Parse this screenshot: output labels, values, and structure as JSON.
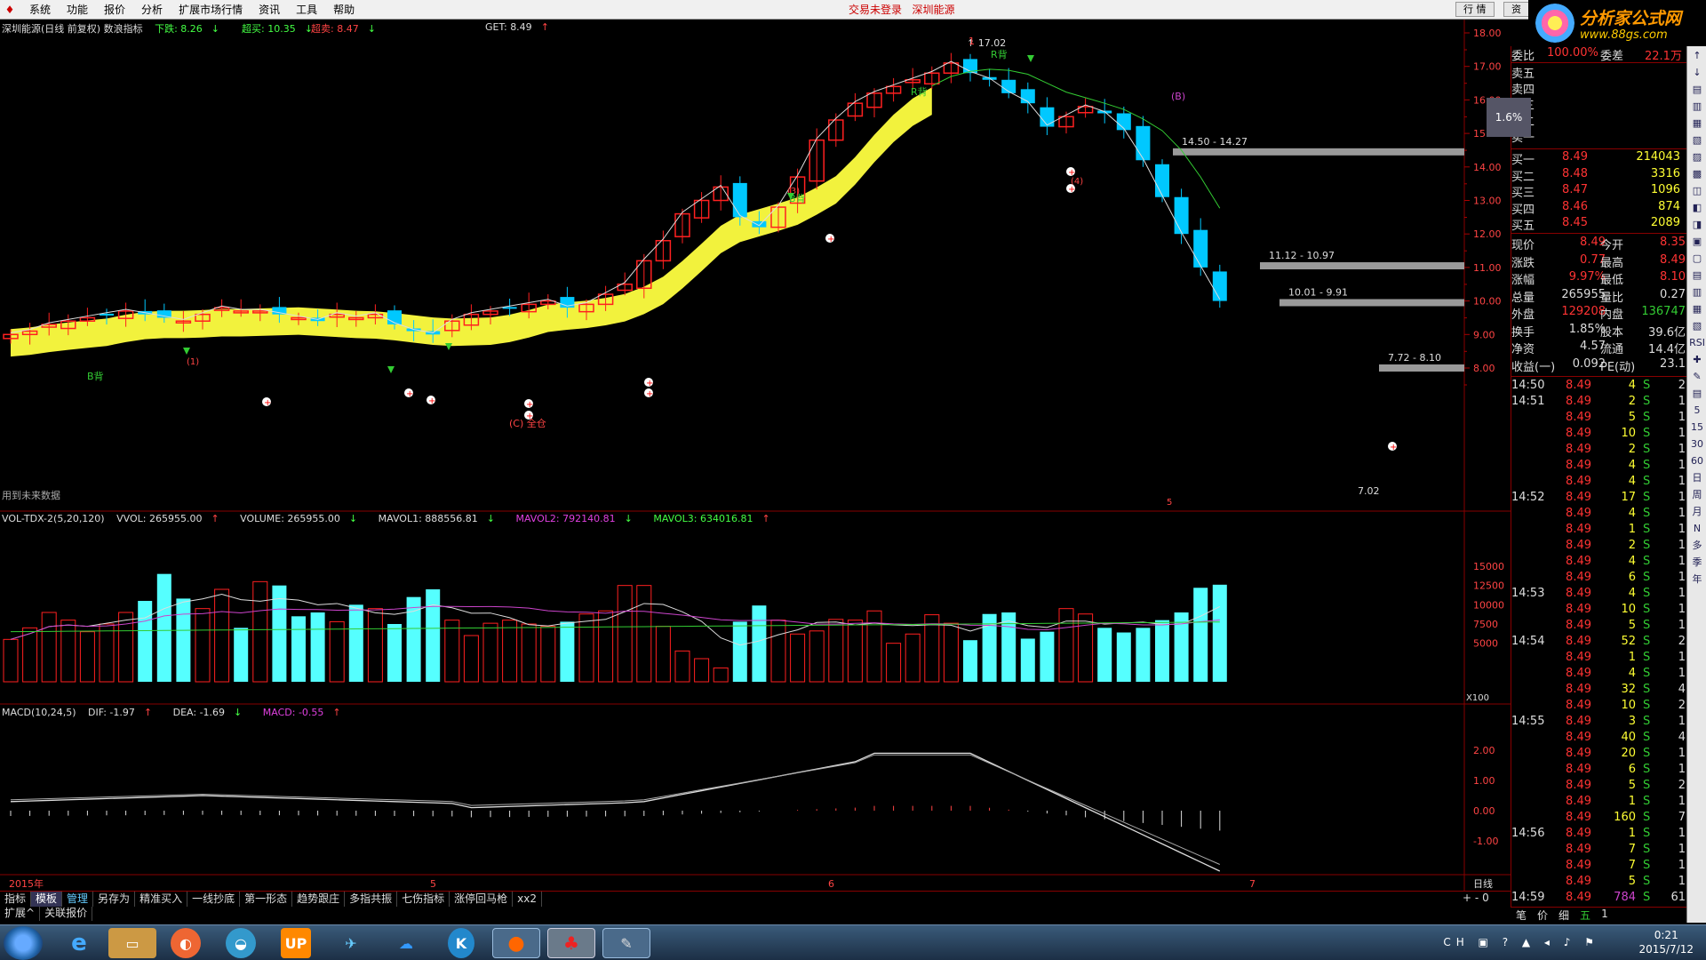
{
  "menu": {
    "items": [
      "系统",
      "功能",
      "报价",
      "分析",
      "扩展市场行情",
      "资讯",
      "工具",
      "帮助"
    ],
    "center_login": "交易未登录",
    "center_stock": "深圳能源",
    "btn_quote": "行 情",
    "btn_info": "资"
  },
  "brand": {
    "title": "分析家公式网",
    "url": "www.88gs.com"
  },
  "main_header": {
    "title": "深圳能源(日线 前复权) 数浪指标",
    "down_label": "下跌: 8.26",
    "down_arrow": "↓",
    "buy_label": "超买: 10.35",
    "buy_arrow": "↓",
    "sell_label": "超卖: 8.47",
    "sell_arrow": "↓",
    "get_label": "GET: 8.49",
    "get_arrow": "↑",
    "future_note": "用到未来数据"
  },
  "price_axis": {
    "ticks": [
      "18.00",
      "17.00",
      "16.00",
      "15.00",
      "14.00",
      "13.00",
      "12.00",
      "11.00",
      "10.00",
      "9.00",
      "8.00"
    ],
    "badge": "1.6%"
  },
  "annotations": {
    "high": "17.02",
    "low": "7.02",
    "z1": "14.50 - 14.27",
    "z2": "11.12 - 10.97",
    "z3": "10.01 - 9.91",
    "z4": "7.72 - 8.10",
    "bbei1": "B背",
    "bbei2": "B背",
    "bbei3": "R背",
    "bbei4": "R背",
    "c_label": "(C) 全仓",
    "b_label": "(B)",
    "n1": "(1)",
    "n3": "(3)",
    "n5": "5",
    "n4": "(4)",
    "one_top": "1"
  },
  "vol_header": {
    "name": "VOL-TDX-2(5,20,120)",
    "vvol": "VVOL: 265955.00",
    "vvol_arrow": "↑",
    "volume": "VOLUME: 265955.00",
    "volume_arrow": "↓",
    "mavol1": "MAVOL1: 888556.81",
    "mavol1_arrow": "↓",
    "mavol2": "MAVOL2: 792140.81",
    "mavol2_arrow": "↓",
    "mavol3": "MAVOL3: 634016.81",
    "mavol3_arrow": "↑"
  },
  "vol_axis": {
    "ticks": [
      "15000",
      "12500",
      "10000",
      "7500",
      "5000"
    ],
    "unit": "X100"
  },
  "macd_header": {
    "name": "MACD(10,24,5)",
    "dif": "DIF: -1.97",
    "dif_arrow": "↑",
    "dea": "DEA: -1.69",
    "dea_arrow": "↓",
    "macd": "MACD: -0.55",
    "macd_arrow": "↑"
  },
  "macd_axis": {
    "ticks": [
      "2.00",
      "1.00",
      "0.00",
      "-1.00"
    ]
  },
  "date_axis": {
    "labels": [
      "2015年",
      "5",
      "6",
      "7"
    ],
    "period": "日线",
    "controls": [
      "+",
      "-",
      "0"
    ]
  },
  "bottom_tabs": [
    "指标",
    "模板",
    "管理",
    "另存为",
    "精准买入",
    "一线抄底",
    "第一形态",
    "趋势跟庄",
    "多指共振",
    "七伤指标",
    "涨停回马枪",
    "xx2"
  ],
  "sub_tabs": [
    "扩展^",
    "关联报价"
  ],
  "quote": {
    "weibi_label": "委比",
    "weibi": "100.00%",
    "weicha_label": "委差",
    "weicha": "22.1万",
    "asks": [
      {
        "label": "卖五"
      },
      {
        "label": "卖四"
      },
      {
        "label": "卖三"
      },
      {
        "label": "卖二"
      },
      {
        "label": "卖一"
      }
    ],
    "bids": [
      {
        "label": "买一",
        "price": "8.49",
        "vol": "214043"
      },
      {
        "label": "买二",
        "price": "8.48",
        "vol": "3316"
      },
      {
        "label": "买三",
        "price": "8.47",
        "vol": "1096"
      },
      {
        "label": "买四",
        "price": "8.46",
        "vol": "874"
      },
      {
        "label": "买五",
        "price": "8.45",
        "vol": "2089"
      }
    ],
    "stats": [
      {
        "l1": "现价",
        "v1": "8.49",
        "l2": "今开",
        "v2": "8.35"
      },
      {
        "l1": "涨跌",
        "v1": "0.77",
        "l2": "最高",
        "v2": "8.49"
      },
      {
        "l1": "涨幅",
        "v1": "9.97%",
        "l2": "最低",
        "v2": "8.10"
      },
      {
        "l1": "总量",
        "v1": "265955",
        "l2": "量比",
        "v2": "0.27"
      },
      {
        "l1": "外盘",
        "v1": "129208",
        "l2": "内盘",
        "v2": "136747"
      },
      {
        "l1": "换手",
        "v1": "1.85%",
        "l2": "股本",
        "v2": "39.6亿"
      },
      {
        "l1": "净资",
        "v1": "4.57",
        "l2": "流通",
        "v2": "14.4亿"
      },
      {
        "l1": "收益(一)",
        "v1": "0.092",
        "l2": "PE(动)",
        "v2": "23.1"
      }
    ],
    "ticks": [
      {
        "t": "14:50",
        "p": "8.49",
        "v": "4",
        "s": "S",
        "n": "2"
      },
      {
        "t": "14:51",
        "p": "8.49",
        "v": "2",
        "s": "S",
        "n": "1"
      },
      {
        "t": "",
        "p": "8.49",
        "v": "5",
        "s": "S",
        "n": "1"
      },
      {
        "t": "",
        "p": "8.49",
        "v": "10",
        "s": "S",
        "n": "1"
      },
      {
        "t": "",
        "p": "8.49",
        "v": "2",
        "s": "S",
        "n": "1"
      },
      {
        "t": "",
        "p": "8.49",
        "v": "4",
        "s": "S",
        "n": "1"
      },
      {
        "t": "",
        "p": "8.49",
        "v": "4",
        "s": "S",
        "n": "1"
      },
      {
        "t": "14:52",
        "p": "8.49",
        "v": "17",
        "s": "S",
        "n": "1"
      },
      {
        "t": "",
        "p": "8.49",
        "v": "4",
        "s": "S",
        "n": "1"
      },
      {
        "t": "",
        "p": "8.49",
        "v": "1",
        "s": "S",
        "n": "1"
      },
      {
        "t": "",
        "p": "8.49",
        "v": "2",
        "s": "S",
        "n": "1"
      },
      {
        "t": "",
        "p": "8.49",
        "v": "4",
        "s": "S",
        "n": "1"
      },
      {
        "t": "",
        "p": "8.49",
        "v": "6",
        "s": "S",
        "n": "1"
      },
      {
        "t": "14:53",
        "p": "8.49",
        "v": "4",
        "s": "S",
        "n": "1"
      },
      {
        "t": "",
        "p": "8.49",
        "v": "10",
        "s": "S",
        "n": "1"
      },
      {
        "t": "",
        "p": "8.49",
        "v": "5",
        "s": "S",
        "n": "1"
      },
      {
        "t": "14:54",
        "p": "8.49",
        "v": "52",
        "s": "S",
        "n": "2"
      },
      {
        "t": "",
        "p": "8.49",
        "v": "1",
        "s": "S",
        "n": "1"
      },
      {
        "t": "",
        "p": "8.49",
        "v": "4",
        "s": "S",
        "n": "1"
      },
      {
        "t": "",
        "p": "8.49",
        "v": "32",
        "s": "S",
        "n": "4"
      },
      {
        "t": "",
        "p": "8.49",
        "v": "10",
        "s": "S",
        "n": "2"
      },
      {
        "t": "14:55",
        "p": "8.49",
        "v": "3",
        "s": "S",
        "n": "1"
      },
      {
        "t": "",
        "p": "8.49",
        "v": "40",
        "s": "S",
        "n": "4"
      },
      {
        "t": "",
        "p": "8.49",
        "v": "20",
        "s": "S",
        "n": "1"
      },
      {
        "t": "",
        "p": "8.49",
        "v": "6",
        "s": "S",
        "n": "1"
      },
      {
        "t": "",
        "p": "8.49",
        "v": "5",
        "s": "S",
        "n": "2"
      },
      {
        "t": "",
        "p": "8.49",
        "v": "1",
        "s": "S",
        "n": "1"
      },
      {
        "t": "",
        "p": "8.49",
        "v": "160",
        "s": "S",
        "n": "7"
      },
      {
        "t": "14:56",
        "p": "8.49",
        "v": "1",
        "s": "S",
        "n": "1"
      },
      {
        "t": "",
        "p": "8.49",
        "v": "7",
        "s": "S",
        "n": "1"
      },
      {
        "t": "",
        "p": "8.49",
        "v": "7",
        "s": "S",
        "n": "1"
      },
      {
        "t": "",
        "p": "8.49",
        "v": "5",
        "s": "S",
        "n": "1"
      },
      {
        "t": "14:59",
        "p": "8.49",
        "v": "784",
        "s": "S",
        "n": "61"
      }
    ],
    "footer": [
      "笔",
      "价",
      "细",
      "五",
      "1"
    ]
  },
  "side_icons": [
    "↑",
    "↓",
    "▤",
    "▥",
    "▦",
    "▧",
    "▨",
    "▩",
    "◫",
    "◧",
    "◨",
    "▣",
    "▢",
    "▤",
    "▥",
    "▦",
    "▧",
    "RSI",
    "✚",
    "✎",
    "▤",
    "5",
    "15",
    "30",
    "60",
    "日",
    "周",
    "月",
    "N",
    "多",
    "季",
    "年"
  ],
  "taskbar": {
    "apps": [
      "",
      "e",
      "",
      "",
      "",
      "UP",
      "",
      "",
      "K",
      "",
      "",
      ""
    ],
    "lang": "CH",
    "time": "0:21",
    "date": "2015/7/12"
  },
  "colors": {
    "up": "#ff2020",
    "down": "#00c8ff",
    "yellow": "#ffff40",
    "cyan": "#55ffff",
    "bg": "#000000",
    "frame": "#800000"
  }
}
